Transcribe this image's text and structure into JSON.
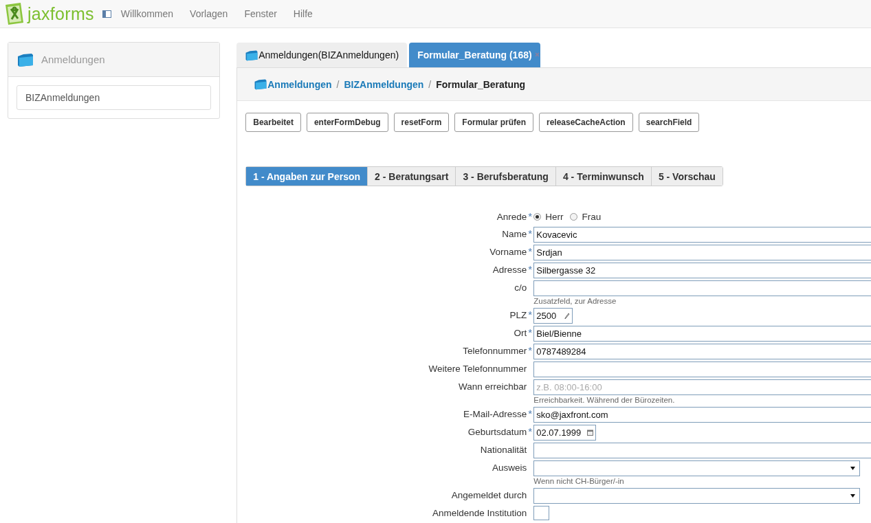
{
  "topbar": {
    "brand": "jaxforms",
    "menu": [
      "Willkommen",
      "Vorlagen",
      "Fenster",
      "Hilfe"
    ]
  },
  "sidebar": {
    "title": "Anmeldungen",
    "items": [
      {
        "label": "BIZAnmeldungen",
        "selected": false
      }
    ]
  },
  "tabs": [
    {
      "label": "Anmeldungen(BIZAnmeldungen)",
      "selected": false,
      "closable": false
    },
    {
      "label": "Formular_Beratung (168)",
      "selected": true,
      "closable": true
    }
  ],
  "breadcrumb": [
    {
      "label": "Anmeldungen",
      "link": true
    },
    {
      "separator": "/",
      "label": "BIZAnmeldungen",
      "link": true
    },
    {
      "separator": "/",
      "label": "Formular_Beratung",
      "link": false
    }
  ],
  "buttons": [
    "Bearbeitet",
    "enterFormDebug",
    "resetForm",
    "Formular prüfen",
    "releaseCacheAction",
    "searchField"
  ],
  "steps": [
    {
      "label": "1 - Angaben zur Person",
      "selected": true
    },
    {
      "label": "2 - Beratungsart",
      "selected": false
    },
    {
      "label": "3 - Berufsberatung",
      "selected": false
    },
    {
      "label": "4 - Terminwunsch",
      "selected": false
    },
    {
      "label": "5 - Vorschau",
      "selected": false
    }
  ],
  "fields": [
    {
      "kind": "radio",
      "label": "Anrede",
      "required_mark": "*",
      "options": [
        {
          "label": "Herr",
          "selected": true
        },
        {
          "label": "Frau",
          "selected": false
        }
      ]
    },
    {
      "kind": "text",
      "label": "Name",
      "required_mark": "*",
      "value": "Kovacevic"
    },
    {
      "kind": "text",
      "label": "Vorname",
      "required_mark": "*",
      "value": "Srdjan"
    },
    {
      "kind": "text",
      "label": "Adresse",
      "required_mark": "*",
      "value": "Silbergasse 32"
    },
    {
      "kind": "text",
      "label": "c/o",
      "hint": "Zusatzfeld, zur Adresse"
    },
    {
      "kind": "plz",
      "label": "PLZ",
      "required_mark": "*",
      "value": "2500"
    },
    {
      "kind": "text",
      "label": "Ort",
      "required_mark": "*",
      "value": "Biel/Bienne"
    },
    {
      "kind": "text",
      "label": "Telefonnummer",
      "required_mark": "*",
      "value": "0787489284"
    },
    {
      "kind": "text",
      "label": "Weitere Telefonnummer"
    },
    {
      "kind": "text",
      "label": "Wann erreichbar",
      "placeholder": "z.B. 08:00-16:00",
      "hint": "Erreichbarkeit. Während der Bürozeiten."
    },
    {
      "kind": "text",
      "label": "E-Mail-Adresse",
      "required_mark": "*",
      "value": "sko@jaxfront.com"
    },
    {
      "kind": "date",
      "label": "Geburtsdatum",
      "required_mark": "*",
      "value": "02.07.1999"
    },
    {
      "kind": "text",
      "label": "Nationalität"
    },
    {
      "kind": "select",
      "label": "Ausweis",
      "hint": "Wenn nicht CH-Bürger/-in"
    },
    {
      "kind": "select",
      "label": "Angemeldet durch"
    },
    {
      "kind": "checkbox",
      "label": "Anmeldende Institution",
      "checked": false
    }
  ]
}
